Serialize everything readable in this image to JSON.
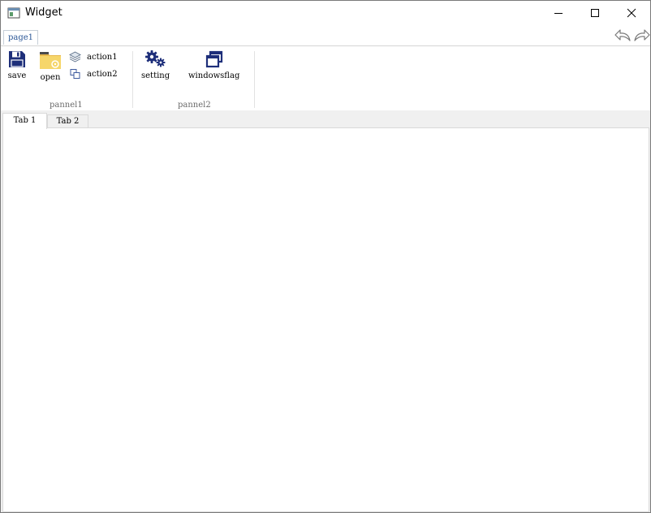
{
  "window": {
    "title": "Widget"
  },
  "ribbon": {
    "tabs": [
      {
        "label": "page1"
      }
    ],
    "groups": [
      {
        "title": "pannel1",
        "buttons": [
          {
            "label": "save",
            "icon": "floppy-disk-icon"
          },
          {
            "label": "open",
            "icon": "folder-open-icon"
          },
          {
            "label": "action1",
            "icon": "layers-icon"
          },
          {
            "label": "action2",
            "icon": "copy-icon"
          }
        ]
      },
      {
        "title": "pannel2",
        "buttons": [
          {
            "label": "setting",
            "icon": "gears-icon"
          },
          {
            "label": "windowsflag",
            "icon": "windows-icon"
          }
        ]
      }
    ]
  },
  "tabs": [
    {
      "label": "Tab 1",
      "active": true
    },
    {
      "label": "Tab 2",
      "active": false
    }
  ],
  "colors": {
    "accent": "#1e2f7a",
    "ribbon_tab_text": "#2b5797",
    "folder": "#f2c94c"
  }
}
